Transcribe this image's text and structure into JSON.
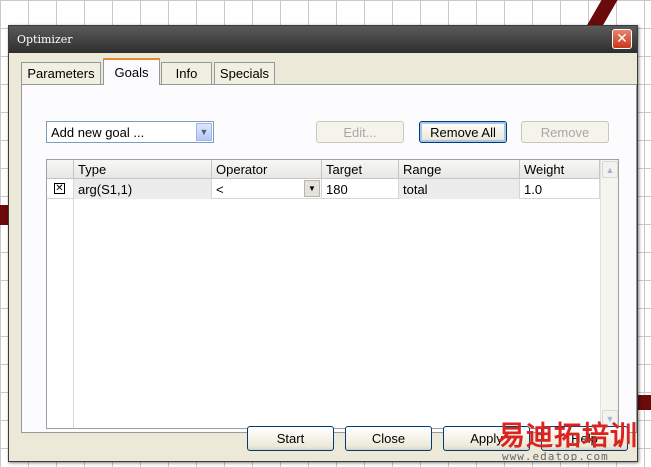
{
  "window": {
    "title": "Optimizer",
    "close_glyph": "✕"
  },
  "tabs": [
    {
      "label": "Parameters",
      "active": false
    },
    {
      "label": "Goals",
      "active": true
    },
    {
      "label": "Info",
      "active": false
    },
    {
      "label": "Specials",
      "active": false
    }
  ],
  "goals": {
    "add_goal_value": "Add new goal ...",
    "buttons": {
      "edit": "Edit...",
      "remove_all": "Remove All",
      "remove": "Remove"
    },
    "columns": [
      "Type",
      "Operator",
      "Target",
      "Range",
      "Weight"
    ],
    "rows": [
      {
        "checked": true,
        "check_glyph": "✕",
        "type": "arg(S1,1)",
        "operator": "<",
        "target": "180",
        "range": "total",
        "weight": "1.0"
      }
    ]
  },
  "footer": {
    "start": "Start",
    "close": "Close",
    "apply": "Apply",
    "help": "Help"
  },
  "watermark": {
    "text": "易迪拓培训",
    "url": "www.edatop.com"
  },
  "icons": {
    "dropdown": "chevron-down-icon",
    "scroll_up": "scroll-up-icon",
    "scroll_down": "scroll-down-icon",
    "close": "close-icon"
  },
  "colors": {
    "titlebar": "#3a3a3a",
    "window_face": "#ece9d8",
    "close_button": "#c5381c",
    "tab_highlight": "#e68b2c",
    "watermark": "#d9241f"
  }
}
